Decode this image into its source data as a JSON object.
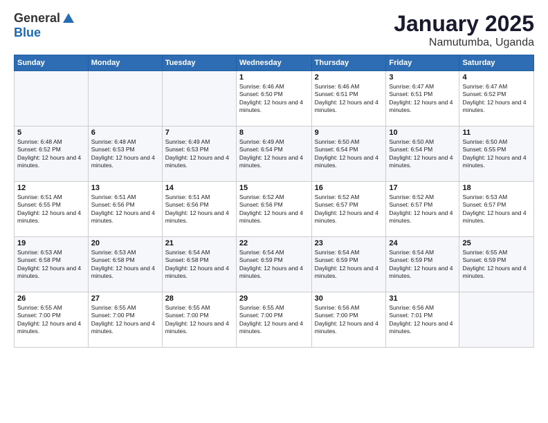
{
  "logo": {
    "general": "General",
    "blue": "Blue"
  },
  "title": "January 2025",
  "subtitle": "Namutumba, Uganda",
  "weekdays": [
    "Sunday",
    "Monday",
    "Tuesday",
    "Wednesday",
    "Thursday",
    "Friday",
    "Saturday"
  ],
  "weeks": [
    [
      {
        "day": "",
        "info": ""
      },
      {
        "day": "",
        "info": ""
      },
      {
        "day": "",
        "info": ""
      },
      {
        "day": "1",
        "info": "Sunrise: 6:46 AM\nSunset: 6:50 PM\nDaylight: 12 hours and 4 minutes."
      },
      {
        "day": "2",
        "info": "Sunrise: 6:46 AM\nSunset: 6:51 PM\nDaylight: 12 hours and 4 minutes."
      },
      {
        "day": "3",
        "info": "Sunrise: 6:47 AM\nSunset: 6:51 PM\nDaylight: 12 hours and 4 minutes."
      },
      {
        "day": "4",
        "info": "Sunrise: 6:47 AM\nSunset: 6:52 PM\nDaylight: 12 hours and 4 minutes."
      }
    ],
    [
      {
        "day": "5",
        "info": "Sunrise: 6:48 AM\nSunset: 6:52 PM\nDaylight: 12 hours and 4 minutes."
      },
      {
        "day": "6",
        "info": "Sunrise: 6:48 AM\nSunset: 6:53 PM\nDaylight: 12 hours and 4 minutes."
      },
      {
        "day": "7",
        "info": "Sunrise: 6:49 AM\nSunset: 6:53 PM\nDaylight: 12 hours and 4 minutes."
      },
      {
        "day": "8",
        "info": "Sunrise: 6:49 AM\nSunset: 6:54 PM\nDaylight: 12 hours and 4 minutes."
      },
      {
        "day": "9",
        "info": "Sunrise: 6:50 AM\nSunset: 6:54 PM\nDaylight: 12 hours and 4 minutes."
      },
      {
        "day": "10",
        "info": "Sunrise: 6:50 AM\nSunset: 6:54 PM\nDaylight: 12 hours and 4 minutes."
      },
      {
        "day": "11",
        "info": "Sunrise: 6:50 AM\nSunset: 6:55 PM\nDaylight: 12 hours and 4 minutes."
      }
    ],
    [
      {
        "day": "12",
        "info": "Sunrise: 6:51 AM\nSunset: 6:55 PM\nDaylight: 12 hours and 4 minutes."
      },
      {
        "day": "13",
        "info": "Sunrise: 6:51 AM\nSunset: 6:56 PM\nDaylight: 12 hours and 4 minutes."
      },
      {
        "day": "14",
        "info": "Sunrise: 6:51 AM\nSunset: 6:56 PM\nDaylight: 12 hours and 4 minutes."
      },
      {
        "day": "15",
        "info": "Sunrise: 6:52 AM\nSunset: 6:56 PM\nDaylight: 12 hours and 4 minutes."
      },
      {
        "day": "16",
        "info": "Sunrise: 6:52 AM\nSunset: 6:57 PM\nDaylight: 12 hours and 4 minutes."
      },
      {
        "day": "17",
        "info": "Sunrise: 6:52 AM\nSunset: 6:57 PM\nDaylight: 12 hours and 4 minutes."
      },
      {
        "day": "18",
        "info": "Sunrise: 6:53 AM\nSunset: 6:57 PM\nDaylight: 12 hours and 4 minutes."
      }
    ],
    [
      {
        "day": "19",
        "info": "Sunrise: 6:53 AM\nSunset: 6:58 PM\nDaylight: 12 hours and 4 minutes."
      },
      {
        "day": "20",
        "info": "Sunrise: 6:53 AM\nSunset: 6:58 PM\nDaylight: 12 hours and 4 minutes."
      },
      {
        "day": "21",
        "info": "Sunrise: 6:54 AM\nSunset: 6:58 PM\nDaylight: 12 hours and 4 minutes."
      },
      {
        "day": "22",
        "info": "Sunrise: 6:54 AM\nSunset: 6:59 PM\nDaylight: 12 hours and 4 minutes."
      },
      {
        "day": "23",
        "info": "Sunrise: 6:54 AM\nSunset: 6:59 PM\nDaylight: 12 hours and 4 minutes."
      },
      {
        "day": "24",
        "info": "Sunrise: 6:54 AM\nSunset: 6:59 PM\nDaylight: 12 hours and 4 minutes."
      },
      {
        "day": "25",
        "info": "Sunrise: 6:55 AM\nSunset: 6:59 PM\nDaylight: 12 hours and 4 minutes."
      }
    ],
    [
      {
        "day": "26",
        "info": "Sunrise: 6:55 AM\nSunset: 7:00 PM\nDaylight: 12 hours and 4 minutes."
      },
      {
        "day": "27",
        "info": "Sunrise: 6:55 AM\nSunset: 7:00 PM\nDaylight: 12 hours and 4 minutes."
      },
      {
        "day": "28",
        "info": "Sunrise: 6:55 AM\nSunset: 7:00 PM\nDaylight: 12 hours and 4 minutes."
      },
      {
        "day": "29",
        "info": "Sunrise: 6:55 AM\nSunset: 7:00 PM\nDaylight: 12 hours and 4 minutes."
      },
      {
        "day": "30",
        "info": "Sunrise: 6:56 AM\nSunset: 7:00 PM\nDaylight: 12 hours and 4 minutes."
      },
      {
        "day": "31",
        "info": "Sunrise: 6:56 AM\nSunset: 7:01 PM\nDaylight: 12 hours and 4 minutes."
      },
      {
        "day": "",
        "info": ""
      }
    ]
  ]
}
